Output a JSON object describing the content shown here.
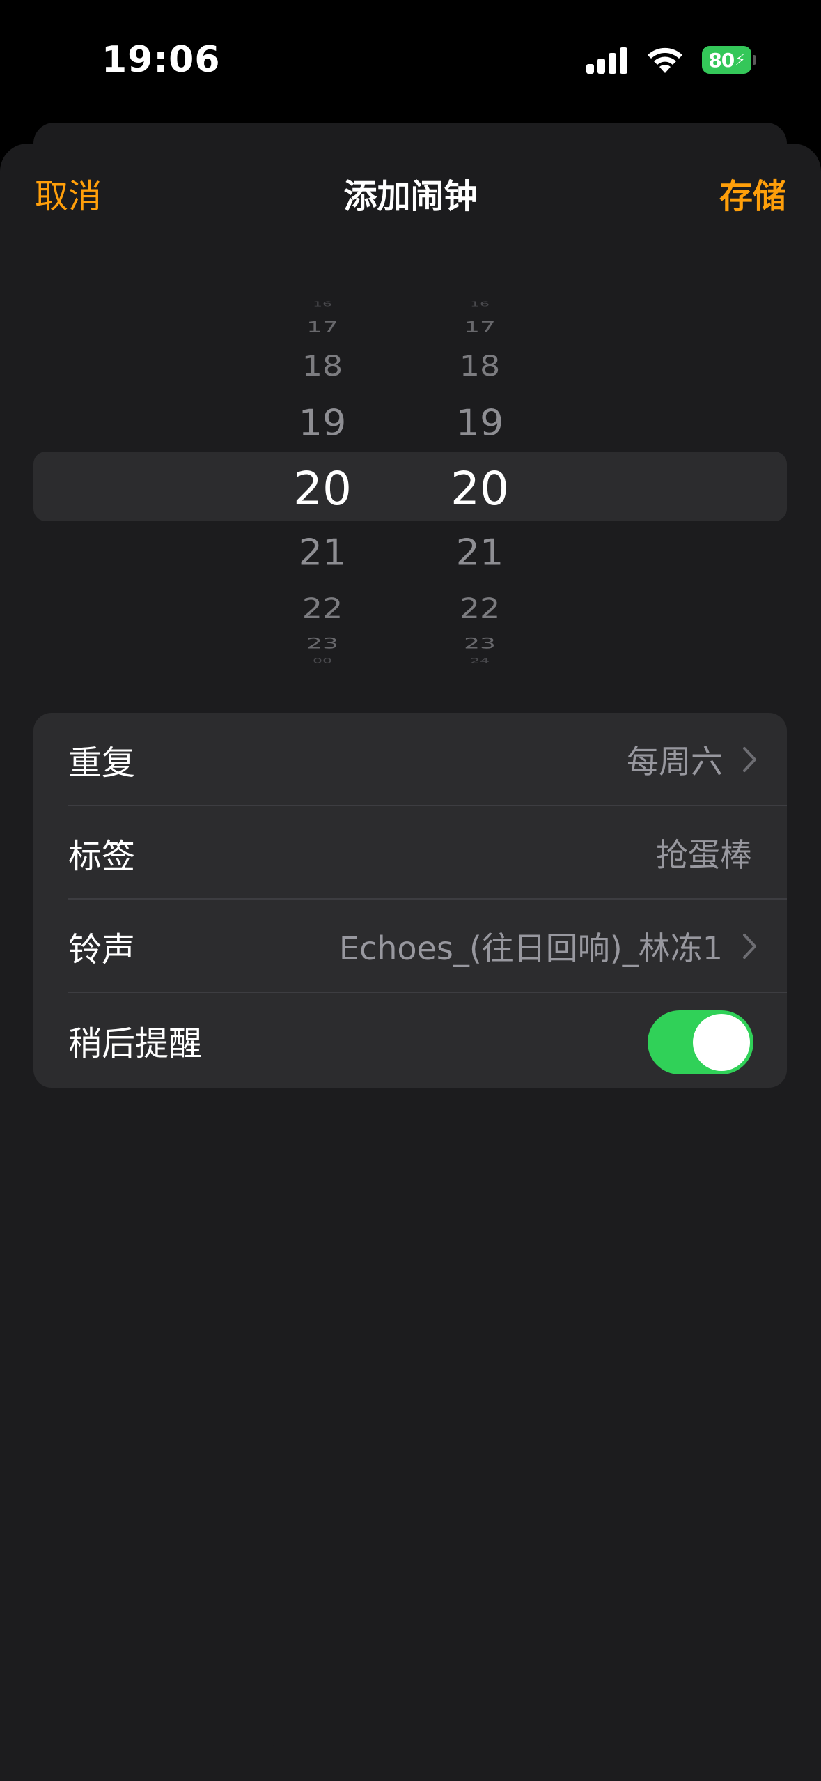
{
  "status_bar": {
    "time": "19:06",
    "battery_level": "80",
    "battery_charging": true,
    "icons": [
      "signal-icon",
      "wifi-icon",
      "battery-icon"
    ]
  },
  "nav": {
    "cancel": "取消",
    "title": "添加闹钟",
    "save": "存储"
  },
  "time_picker": {
    "hour": {
      "above": [
        "16",
        "17",
        "18",
        "19"
      ],
      "selected": "20",
      "below": [
        "21",
        "22",
        "23",
        "00"
      ]
    },
    "minute": {
      "above": [
        "16",
        "17",
        "18",
        "19"
      ],
      "selected": "20",
      "below": [
        "21",
        "22",
        "23",
        "24"
      ]
    }
  },
  "settings": {
    "repeat": {
      "label": "重复",
      "value": "每周六"
    },
    "label": {
      "label": "标签",
      "value": "抢蛋棒"
    },
    "sound": {
      "label": "铃声",
      "value": "Echoes_(往日回响)_林冻1"
    },
    "snooze": {
      "label": "稍后提醒",
      "enabled": true
    }
  },
  "colors": {
    "accent": "#ff9f0a",
    "toggle_on": "#30d158",
    "battery": "#34c759",
    "background": "#1c1c1e",
    "group_background": "#2c2c2e"
  }
}
